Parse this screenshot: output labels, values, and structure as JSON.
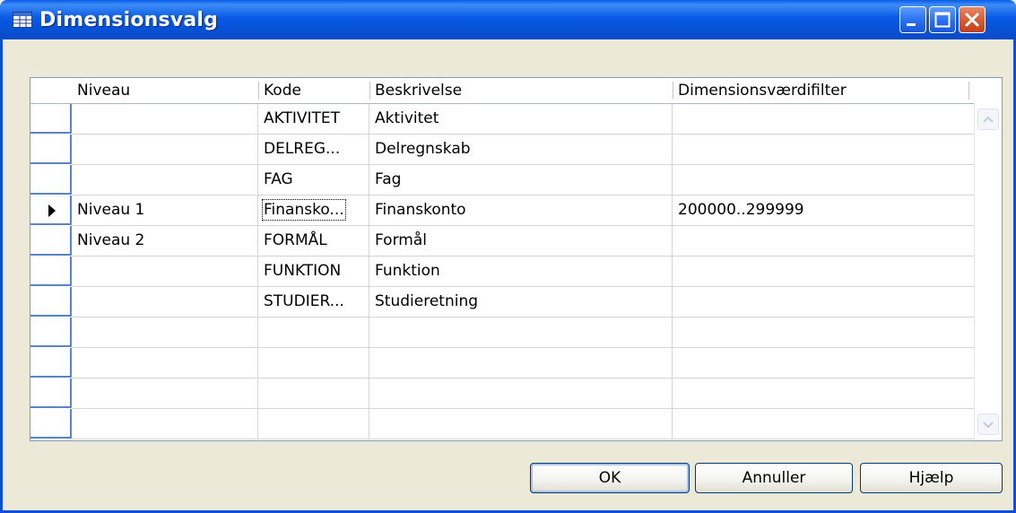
{
  "window": {
    "title": "Dimensionsvalg",
    "icon": "table-icon",
    "accent": "#0a5ae6",
    "controls": [
      "minimize-icon",
      "maximize-icon",
      "close-icon"
    ]
  },
  "grid": {
    "columns": [
      "Niveau",
      "Kode",
      "Beskrivelse",
      "Dimensionsværdifilter"
    ],
    "rows": [
      {
        "niveau": "",
        "kode": "AKTIVITET",
        "beskrivelse": "Aktivitet",
        "filter": ""
      },
      {
        "niveau": "",
        "kode": "DELREG...",
        "beskrivelse": "Delregnskab",
        "filter": ""
      },
      {
        "niveau": "",
        "kode": "FAG",
        "beskrivelse": "Fag",
        "filter": ""
      },
      {
        "niveau": "Niveau 1",
        "kode": "Finansko...",
        "beskrivelse": "Finanskonto",
        "filter": "200000..299999"
      },
      {
        "niveau": "Niveau 2",
        "kode": "FORMÅL",
        "beskrivelse": "Formål",
        "filter": ""
      },
      {
        "niveau": "",
        "kode": "FUNKTION",
        "beskrivelse": "Funktion",
        "filter": ""
      },
      {
        "niveau": "",
        "kode": "STUDIER...",
        "beskrivelse": "Studieretning",
        "filter": ""
      },
      {
        "niveau": "",
        "kode": "",
        "beskrivelse": "",
        "filter": ""
      },
      {
        "niveau": "",
        "kode": "",
        "beskrivelse": "",
        "filter": ""
      },
      {
        "niveau": "",
        "kode": "",
        "beskrivelse": "",
        "filter": ""
      },
      {
        "niveau": "",
        "kode": "",
        "beskrivelse": "",
        "filter": ""
      }
    ],
    "current_row": 3
  },
  "buttons": {
    "ok": "OK",
    "cancel": "Annuller",
    "help": "Hjælp"
  }
}
